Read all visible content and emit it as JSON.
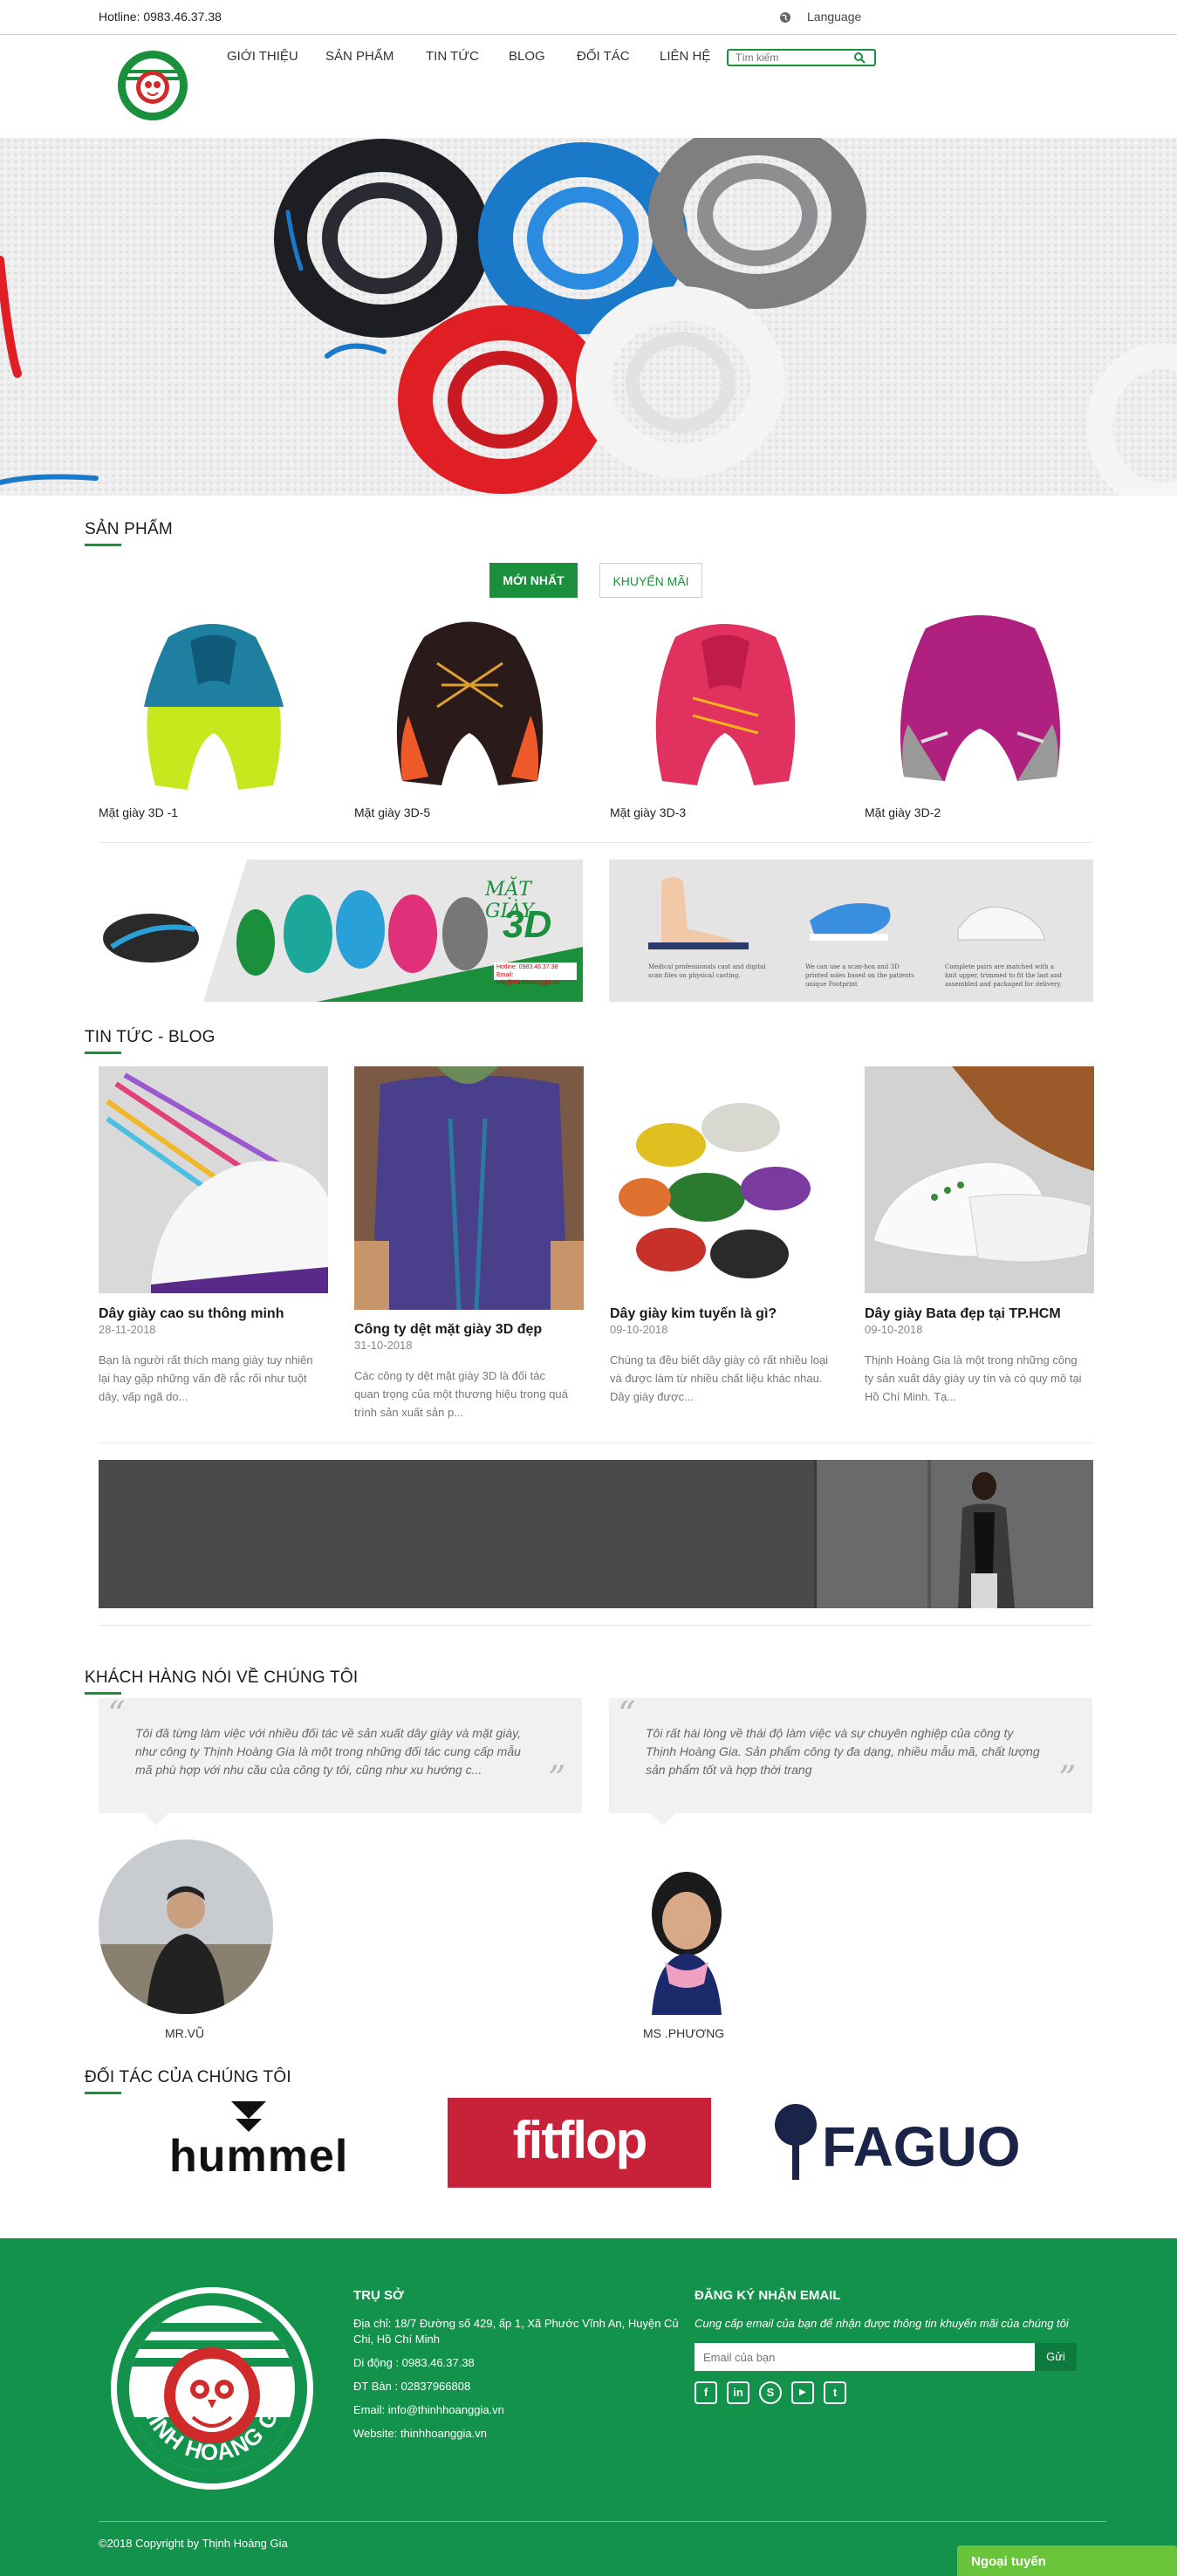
{
  "topbar": {
    "hotline": "Hotline: 0983.46.37.38",
    "language": "Language"
  },
  "nav": {
    "items": [
      "GIỚI THIỆU",
      "SẢN PHẨM",
      "TIN TỨC",
      "BLOG",
      "ĐỐI TÁC",
      "LIÊN HỆ"
    ],
    "search_placeholder": "Tìm kiếm"
  },
  "products": {
    "title": "SẢN PHẨM",
    "tabs": [
      "MỚI NHẤT",
      "KHUYẾN MÃI"
    ],
    "items": [
      "Mặt giày 3D -1",
      "Mặt giày 3D-5",
      "Mặt giày 3D-3",
      "Mặt giày 3D-2"
    ]
  },
  "banner": {
    "title_line1": "MẶT GIÀY",
    "title_line2": "3D",
    "hotline": "Hotline: 0983.46.37.38",
    "email": "Email: info@thinhhoanggia.vn",
    "captions": [
      "Medical professionals cast and digital scan files on physical casting.",
      "We can use a scan-box and 3D printed soles based on the patients unique Footprint",
      "Complete pairs are matched with a knit upper, trimmed to fit the last and assembled and packaged for delivery."
    ]
  },
  "news": {
    "title": "TIN TỨC - BLOG",
    "items": [
      {
        "title": "Dây giày cao su thông minh",
        "date": "28-11-2018",
        "desc": [
          "Bạn là người rất thích mang giày tuy nhiên",
          "lại hay gặp những vấn đề rắc rối như tuột",
          "dây, vấp ngã do..."
        ]
      },
      {
        "title": "Công ty dệt mặt giày 3D đẹp",
        "date": "31-10-2018",
        "desc": [
          "Các công ty dệt mặt giày 3D là đối tác",
          "quan trọng của một thương hiệu trong quá",
          "trình sản xuất sản p..."
        ]
      },
      {
        "title": "Dây giày kim tuyến là gì?",
        "date": "09-10-2018",
        "desc": [
          "Chúng ta đều biết dây giày có rất nhiều loại",
          "và được làm từ nhiều chất liệu khác nhau.",
          "Dây giày được..."
        ]
      },
      {
        "title": "Dây giày Bata đẹp tại TP.HCM",
        "date": "09-10-2018",
        "desc": [
          "Thịnh Hoàng Gia là một trong những công",
          "ty sản xuất dây giày uy tín và có quy mô tại",
          "Hồ Chí Minh. Tạ..."
        ]
      }
    ]
  },
  "testimonials": {
    "title": "KHÁCH HÀNG NÓI VỀ CHÚNG TÔI",
    "items": [
      {
        "lines": [
          "Tôi đã từng làm việc với nhiều đối tác về sản xuất dây giày và mặt giày,",
          "như công ty Thịnh Hoàng Gia là một trong những đối tác cung cấp mẫu",
          "mã phù hợp với nhu cầu của công ty tôi, cũng như xu hướng c..."
        ],
        "name": "MR.VŨ"
      },
      {
        "lines": [
          "Tôi rất hài lòng về thái độ làm việc và sự chuyên nghiệp của công ty",
          "Thịnh Hoàng Gia. Sản phẩm công ty đa dạng, nhiều mẫu mã, chất lượng",
          "sản phẩm tốt và hợp thời trang"
        ],
        "name": "MS .PHƯƠNG"
      }
    ]
  },
  "partners": {
    "title": "ĐỐI TÁC CỦA CHÚNG TÔI",
    "logos": [
      "hummel",
      "fitflop",
      "FAGUO"
    ]
  },
  "footer": {
    "logo_text": "THINH HOANG GIA",
    "hq_title": "TRỤ SỞ",
    "address": [
      "Địa chỉ: 18/7 Đường số 429, ấp 1, Xã Phước Vĩnh An, Huyện Củ",
      "Chi, Hồ Chí Minh"
    ],
    "mobile": "Di động : 0983.46.37.38",
    "phone": "ĐT Bàn : 02837966808",
    "email": "Email: info@thinhhoanggia.vn",
    "website": "Website: thinhhoanggia.vn",
    "subscribe_title": "ĐĂNG KÝ NHẬN EMAIL",
    "subscribe_desc": "Cung cấp email của bạn để nhận được thông tin khuyến mãi của chúng tôi",
    "email_placeholder": "Email của bạn",
    "send": "Gửi",
    "social": [
      "f",
      "in",
      "S",
      "▶",
      "t"
    ],
    "copyright": "©2018 Copyright by Thịnh Hoàng Gia",
    "offline": "Ngoại tuyến"
  },
  "colors": {
    "brand": "#1a8f3c",
    "footer": "#12924a"
  }
}
